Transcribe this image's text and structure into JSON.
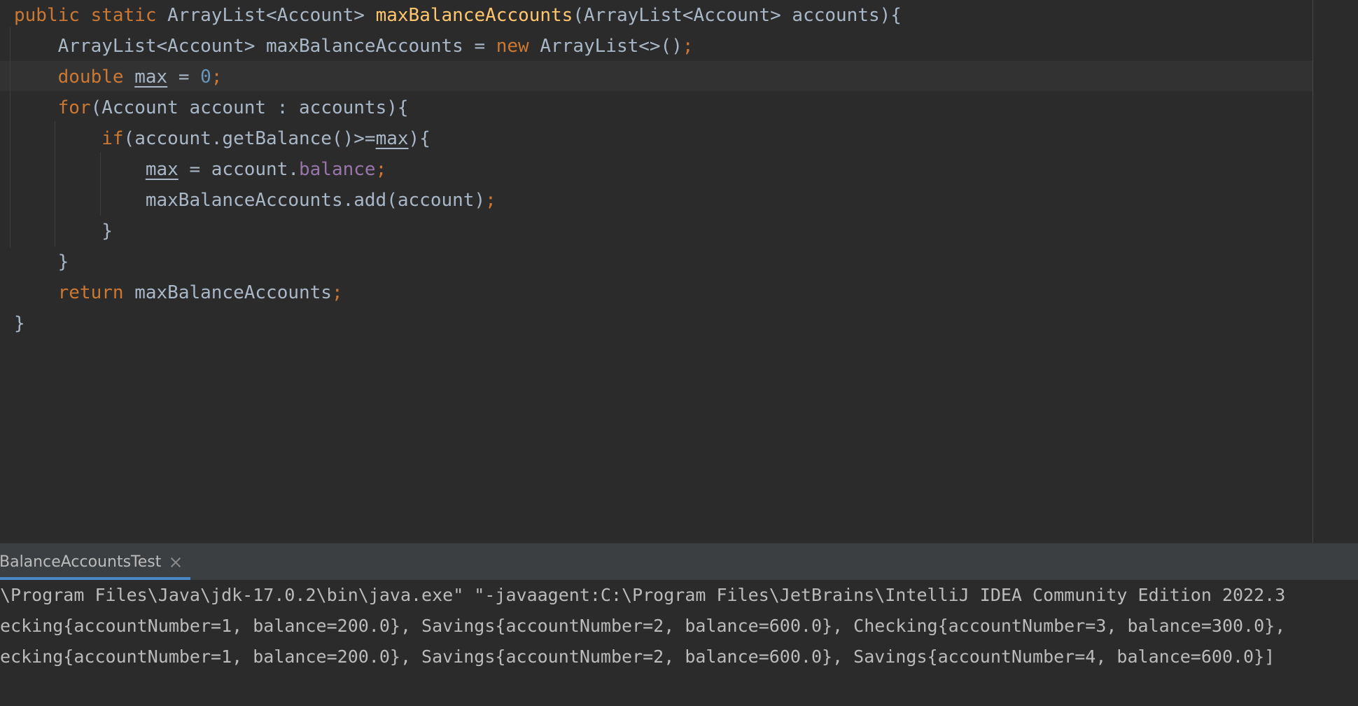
{
  "editor": {
    "lines": [
      {
        "tokens": [
          {
            "t": "public static ",
            "c": "k"
          },
          {
            "t": "ArrayList<Account> ",
            "c": "p"
          },
          {
            "t": "maxBalanceAccounts",
            "c": "fn"
          },
          {
            "t": "(ArrayList<Account> accounts){",
            "c": "p"
          }
        ]
      },
      {
        "tokens": [
          {
            "t": "    ArrayList<Account> maxBalanceAccounts = ",
            "c": "p"
          },
          {
            "t": "new ",
            "c": "k"
          },
          {
            "t": "ArrayList<>()",
            "c": "p"
          },
          {
            "t": ";",
            "c": "k"
          }
        ]
      },
      {
        "tokens": [
          {
            "t": "    ",
            "c": "p"
          },
          {
            "t": "double ",
            "c": "k"
          },
          {
            "t": "max",
            "c": "u"
          },
          {
            "t": " = ",
            "c": "p"
          },
          {
            "t": "0",
            "c": "num"
          },
          {
            "t": ";",
            "c": "k"
          }
        ]
      },
      {
        "tokens": [
          {
            "t": "    ",
            "c": "p"
          },
          {
            "t": "for",
            "c": "k"
          },
          {
            "t": "(Account account : accounts){",
            "c": "p"
          }
        ]
      },
      {
        "tokens": [
          {
            "t": "        ",
            "c": "p"
          },
          {
            "t": "if",
            "c": "k"
          },
          {
            "t": "(account.getBalance()>=",
            "c": "p"
          },
          {
            "t": "max",
            "c": "u"
          },
          {
            "t": "){",
            "c": "p"
          }
        ]
      },
      {
        "tokens": [
          {
            "t": "            ",
            "c": "p"
          },
          {
            "t": "max",
            "c": "u"
          },
          {
            "t": " = account.",
            "c": "p"
          },
          {
            "t": "balance",
            "c": "fld"
          },
          {
            "t": ";",
            "c": "k"
          }
        ]
      },
      {
        "tokens": [
          {
            "t": "            maxBalanceAccounts.add(account)",
            "c": "p"
          },
          {
            "t": ";",
            "c": "k"
          }
        ]
      },
      {
        "tokens": [
          {
            "t": "        }",
            "c": "p"
          }
        ]
      },
      {
        "tokens": [
          {
            "t": "    }",
            "c": "p"
          }
        ]
      },
      {
        "tokens": [
          {
            "t": "    ",
            "c": "p"
          },
          {
            "t": "return ",
            "c": "k"
          },
          {
            "t": "maxBalanceAccounts",
            "c": "p"
          },
          {
            "t": ";",
            "c": "k"
          }
        ]
      },
      {
        "tokens": [
          {
            "t": "}",
            "c": "p"
          }
        ]
      }
    ]
  },
  "run": {
    "tab_label": "BalanceAccountsTest",
    "console_lines": [
      "\\Program Files\\Java\\jdk-17.0.2\\bin\\java.exe\" \"-javaagent:C:\\Program Files\\JetBrains\\IntelliJ IDEA Community Edition 2022.3",
      "ecking{accountNumber=1, balance=200.0}, Savings{accountNumber=2, balance=600.0}, Checking{accountNumber=3, balance=300.0},",
      "ecking{accountNumber=1, balance=200.0}, Savings{accountNumber=2, balance=600.0}, Savings{accountNumber=4, balance=600.0}]"
    ]
  },
  "colors": {
    "background": "#2b2b2b",
    "plain": "#a9b7c6",
    "keyword": "#cc7832",
    "method_declaration": "#ffc66d",
    "number": "#6897bb",
    "field": "#9876aa",
    "tab_underline": "#4a88c7"
  },
  "icons": {
    "close_tab": "close-icon"
  }
}
